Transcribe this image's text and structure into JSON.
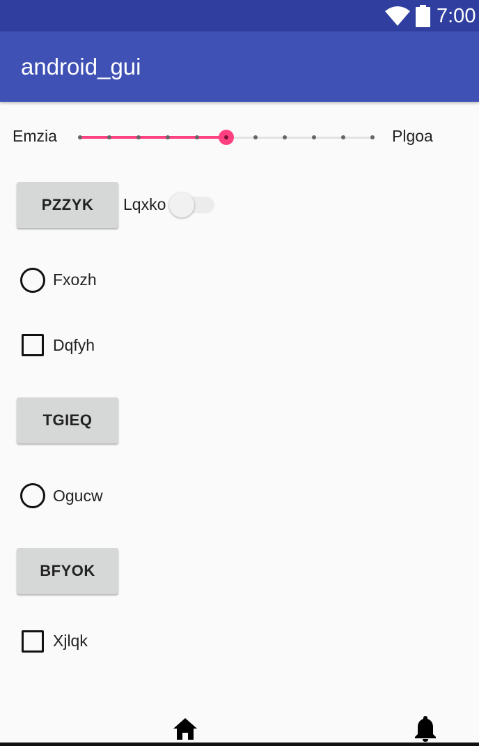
{
  "status_bar": {
    "time": "7:00",
    "wifi_icon": "wifi-icon",
    "battery_icon": "battery-icon"
  },
  "app_bar": {
    "title": "android_gui"
  },
  "seekbar": {
    "left_label": "Emzia",
    "right_label": "Plgoa",
    "steps": 10,
    "value": 5,
    "accent": "#ff4081"
  },
  "controls": {
    "button_1": "PZZYK",
    "switch_label": "Lqxko",
    "switch_on": false,
    "radio_1": "Fxozh",
    "checkbox_1": "Dqfyh",
    "button_2": "TGIEQ",
    "radio_2": "Ogucw",
    "button_3": "BFYOK",
    "checkbox_2": "Xjlqk"
  },
  "bottom_nav": {
    "home_icon": "home-icon",
    "bell_icon": "bell-icon"
  },
  "colors": {
    "status_bar": "#303f9f",
    "app_bar": "#3f51b5",
    "accent": "#ff4081"
  }
}
